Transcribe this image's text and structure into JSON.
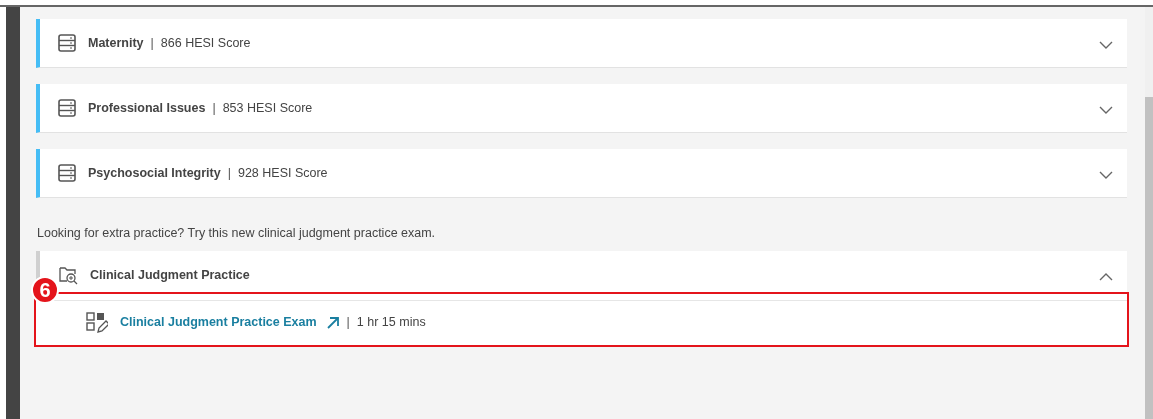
{
  "score_sections": [
    {
      "name": "Maternity",
      "separator": "|",
      "score": "866 HESI Score",
      "expanded": false
    },
    {
      "name": "Professional Issues",
      "separator": "|",
      "score": "853 HESI Score",
      "expanded": false
    },
    {
      "name": "Psychosocial Integrity",
      "separator": "|",
      "score": "928 HESI Score",
      "expanded": false
    }
  ],
  "promo_text": "Looking for extra practice? Try this new clinical judgment practice exam.",
  "practice": {
    "title": "Clinical Judgment Practice",
    "expanded": true,
    "items": [
      {
        "title": "Clinical Judgment Practice Exam",
        "separator": "|",
        "duration": "1 hr 15 mins"
      }
    ]
  },
  "callout": {
    "label": "6"
  }
}
